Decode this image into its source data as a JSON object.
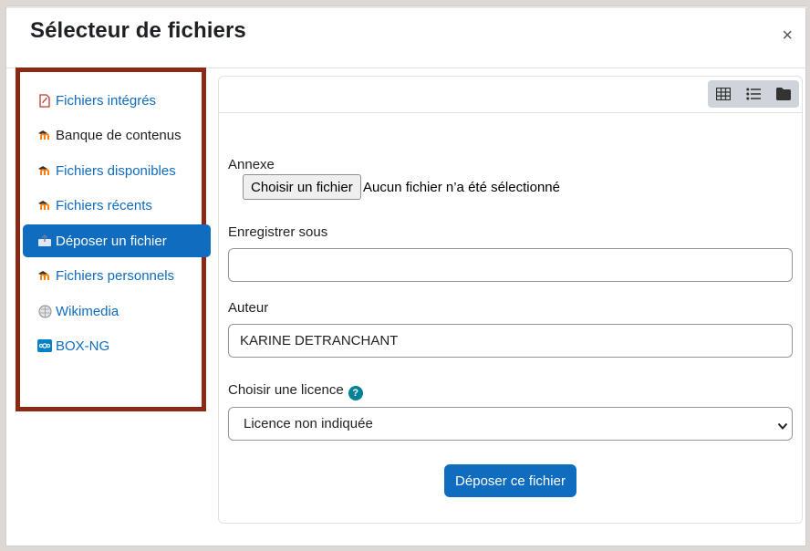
{
  "dialog": {
    "title": "Sélecteur de fichiers",
    "close_label": "×"
  },
  "sidebar": {
    "items": [
      {
        "label": "Fichiers intégrés",
        "icon": "embedded-file-icon",
        "active": false
      },
      {
        "label": "Banque de contenus",
        "icon": "moodle-icon",
        "active": false
      },
      {
        "label": "Fichiers disponibles",
        "icon": "moodle-icon",
        "active": false
      },
      {
        "label": "Fichiers récents",
        "icon": "moodle-icon",
        "active": false
      },
      {
        "label": "Déposer un fichier",
        "icon": "upload-icon",
        "active": true
      },
      {
        "label": "Fichiers personnels",
        "icon": "moodle-icon",
        "active": false
      },
      {
        "label": "Wikimedia",
        "icon": "wikimedia-icon",
        "active": false
      },
      {
        "label": "BOX-NG",
        "icon": "box-icon",
        "active": false
      }
    ],
    "highlight_color": "#8b2a14",
    "active_color": "#0f6cbf"
  },
  "toolbar": {
    "views": [
      "grid-icon",
      "list-icon",
      "folder-icon"
    ]
  },
  "form": {
    "attachment_label": "Annexe",
    "choose_button": "Choisir un fichier",
    "no_file_text": "Aucun fichier n’a été sélectionné",
    "save_as_label": "Enregistrer sous",
    "save_as_value": "",
    "author_label": "Auteur",
    "author_value": "KARINE DETRANCHANT",
    "license_label": "Choisir une licence",
    "license_value": "Licence non indiquée",
    "submit_label": "Déposer ce fichier"
  }
}
